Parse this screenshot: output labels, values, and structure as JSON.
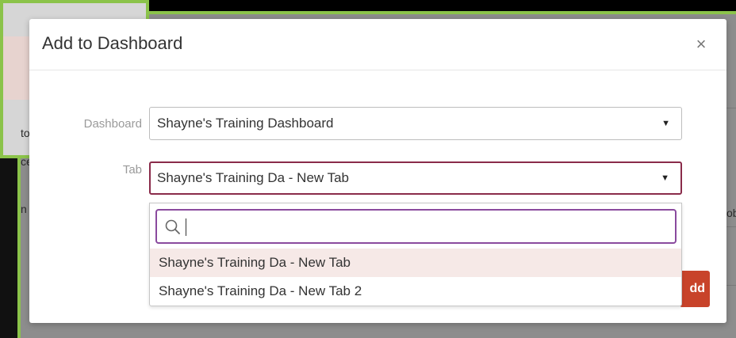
{
  "background": {
    "fragments": [
      "to",
      "ce",
      "n l",
      "ob"
    ]
  },
  "modal": {
    "title": "Add to Dashboard",
    "close_glyph": "×",
    "dashboard_label": "Dashboard",
    "dashboard_value": "Shayne's Training Dashboard",
    "tab_label": "Tab",
    "tab_value": "Shayne's Training Da - New Tab",
    "add_button_label": "dd"
  },
  "dropdown": {
    "search_value": "",
    "options": [
      {
        "label": "Shayne's Training Da - New Tab",
        "highlighted": true
      },
      {
        "label": "Shayne's Training Da - New Tab 2",
        "highlighted": false
      }
    ]
  },
  "icons": {
    "caret": "caret-down-icon",
    "search": "search-icon",
    "close": "close-icon"
  },
  "colors": {
    "accent_border": "#8bc34a",
    "focus_border": "#8a2b4a",
    "search_border": "#8a4a9e",
    "add_button": "#c8432a",
    "highlight": "#f6e9e7"
  }
}
